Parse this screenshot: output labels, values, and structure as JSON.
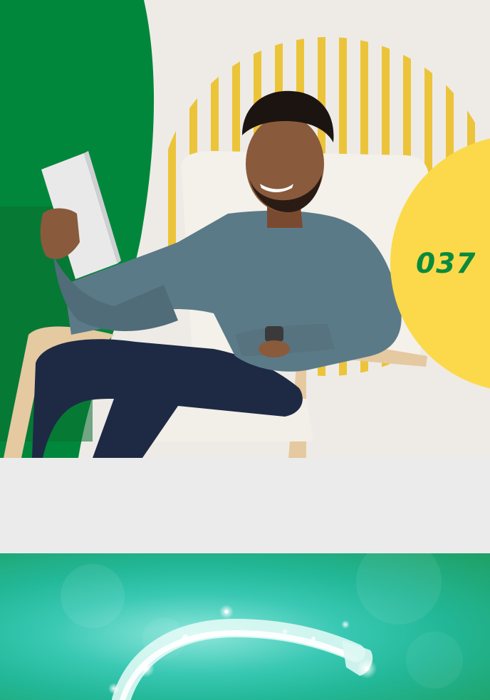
{
  "hero": {
    "page_number": "037",
    "colors": {
      "green": "#00873b",
      "yellow": "#fcd94a",
      "stripe": "#ecc43a",
      "wall": "#eeebe6"
    }
  },
  "promo": {
    "colors": {
      "teal": "#2fc2aa",
      "green": "#1f9f64"
    },
    "icon": "sparkling-ring-icon"
  }
}
